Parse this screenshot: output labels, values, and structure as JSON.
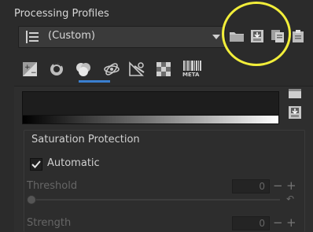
{
  "profiles": {
    "title": "Processing Profiles",
    "selected": "(Custom)"
  },
  "tabs": [
    "exposure",
    "detail",
    "color",
    "advanced",
    "transform",
    "raw",
    "metadata"
  ],
  "tabs_meta_label": "META",
  "saturation_protection": {
    "title": "Saturation Protection",
    "automatic_label": "Automatic",
    "automatic_checked": true,
    "threshold_label": "Threshold",
    "threshold_value": "0",
    "strength_label": "Strength",
    "strength_value": "0"
  },
  "colors": {
    "background": "#2b2b2b",
    "highlight": "#f2ee3a",
    "tab_active": "#3a7fd0"
  }
}
